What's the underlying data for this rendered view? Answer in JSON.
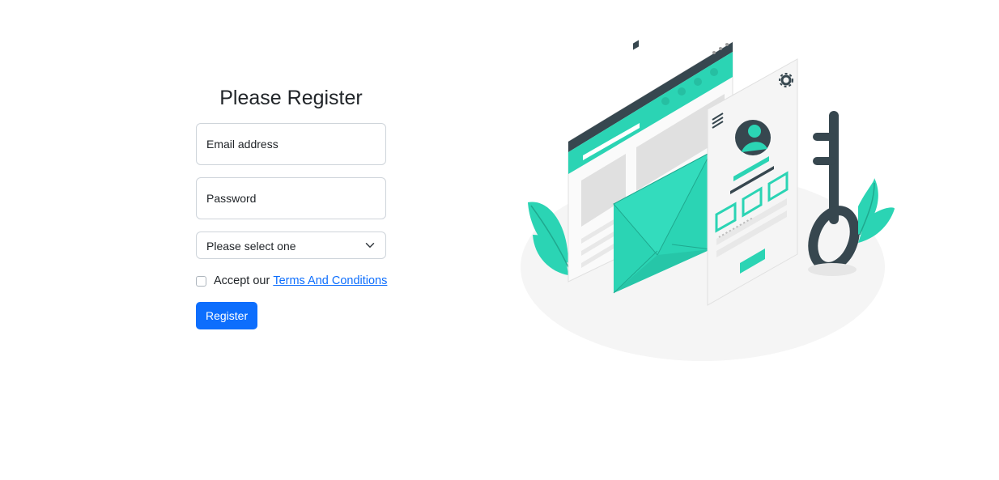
{
  "form": {
    "title": "Please Register",
    "email_label": "Email address",
    "password_label": "Password",
    "select_value": "Please select one",
    "terms_prefix": "Accept our",
    "terms_link": "Terms And Conditions",
    "register_label": "Register"
  },
  "colors": {
    "primary": "#0d6efd",
    "accent": "#2bd4b4",
    "dark": "#37474f"
  }
}
